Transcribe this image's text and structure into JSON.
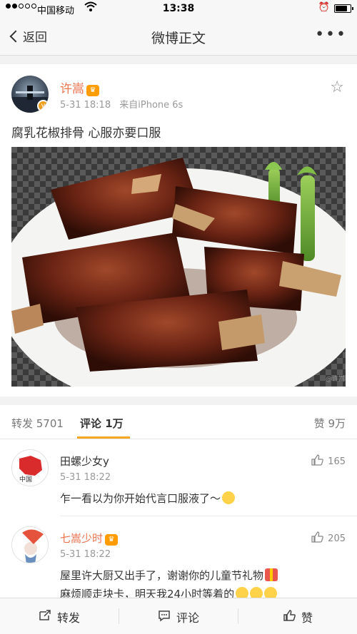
{
  "status_bar": {
    "carrier": "中国移动",
    "time": "13:38",
    "battery_level": 0.85
  },
  "nav": {
    "back_label": "返回",
    "title": "微博正文",
    "more_label": "•••"
  },
  "post": {
    "author": "许嵩",
    "time": "5-31 18:18",
    "source": "来自iPhone 6s",
    "text": "腐乳花椒排骨 心服亦要口服",
    "watermark": "@许嵩"
  },
  "tabs": [
    {
      "label": "转发 5701"
    },
    {
      "label": "评论 1万"
    },
    {
      "label": "赞 9万"
    }
  ],
  "comments": [
    {
      "name": "田螺少女y",
      "time": "5-31 18:22",
      "likes": "165",
      "text": "乍一看以为你开始代言口服液了～",
      "vip": false
    },
    {
      "name": "七嵩少时",
      "time": "5-31 18:22",
      "likes": "205",
      "text_line1": "屋里许大厨又出手了，谢谢你的儿童节礼物",
      "text_line2": "麻烦顺走块卡，明天我24小时等着的",
      "vip": true
    }
  ],
  "toolbar": {
    "repost_label": "转发",
    "comment_label": "评论",
    "like_label": "赞"
  },
  "colors": {
    "accent": "#f5a623",
    "username": "#eb7350",
    "vip_badge": "#ff9c00"
  }
}
